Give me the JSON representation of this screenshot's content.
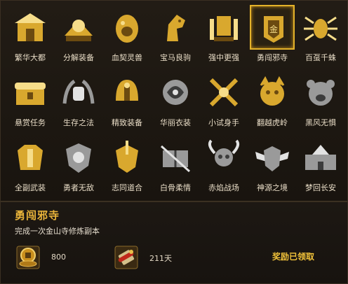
{
  "achievements": [
    {
      "label": "繁华大都",
      "icon": "palace-gate-icon",
      "style": "gold"
    },
    {
      "label": "分解装备",
      "icon": "decompose-gear-icon",
      "style": "gold"
    },
    {
      "label": "血契灵兽",
      "icon": "beast-egg-icon",
      "style": "gold"
    },
    {
      "label": "宝马良驹",
      "icon": "horse-head-icon",
      "style": "gold"
    },
    {
      "label": "强中更强",
      "icon": "trophy-banner-icon",
      "style": "gold"
    },
    {
      "label": "勇闯邪寺",
      "icon": "gold-banner-icon",
      "style": "gold"
    },
    {
      "label": "百虿千蛛",
      "icon": "spider-icon",
      "style": "gold"
    },
    {
      "label": "悬赏任务",
      "icon": "scroll-chest-icon",
      "style": "gold"
    },
    {
      "label": "生存之法",
      "icon": "laurel-urn-icon",
      "style": "silver"
    },
    {
      "label": "精致装备",
      "icon": "helmet-icon",
      "style": "gold"
    },
    {
      "label": "华丽衣装",
      "icon": "dragon-emblem-icon",
      "style": "silver"
    },
    {
      "label": "小试身手",
      "icon": "crossed-swords-icon",
      "style": "gold"
    },
    {
      "label": "翻越虎岭",
      "icon": "tiger-head-icon",
      "style": "gold"
    },
    {
      "label": "黑风无惧",
      "icon": "bear-head-icon",
      "style": "silver"
    },
    {
      "label": "全副武装",
      "icon": "armor-icon",
      "style": "gold"
    },
    {
      "label": "勇者无敌",
      "icon": "flower-shield-icon",
      "style": "silver"
    },
    {
      "label": "志同道合",
      "icon": "flag-shield-icon",
      "style": "gold"
    },
    {
      "label": "白骨柔情",
      "icon": "bone-book-icon",
      "style": "silver"
    },
    {
      "label": "赤焰战场",
      "icon": "horned-skull-icon",
      "style": "silver"
    },
    {
      "label": "神源之境",
      "icon": "winged-shield-icon",
      "style": "silver"
    },
    {
      "label": "梦回长安",
      "icon": "city-wall-icon",
      "style": "silver"
    }
  ],
  "selected": "勇闯邪寺",
  "detail": {
    "title": "勇闯邪寺",
    "description": "完成一次金山寺修炼副本",
    "rewards": [
      {
        "icon": "coin-stack-icon",
        "value": "800"
      },
      {
        "icon": "red-scroll-icon",
        "value": "211天"
      }
    ],
    "status": "奖励已领取"
  },
  "colors": {
    "gold": "#d9a82e",
    "silver": "#9a9a9a",
    "title": "#e9b43a",
    "status": "#f2c33a"
  }
}
